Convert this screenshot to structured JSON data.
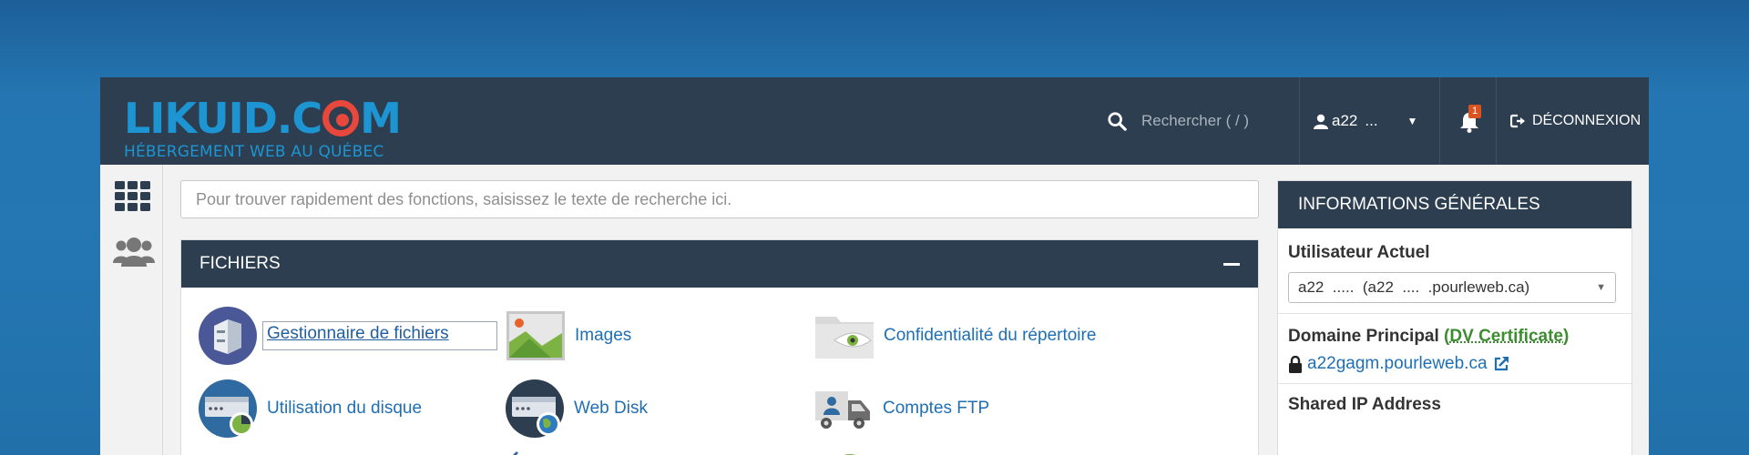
{
  "brand": {
    "logo_pre": "LIKUID.C",
    "logo_post": "M",
    "tagline": "HÉBERGEMENT WEB AU QUÉBEC"
  },
  "topbar": {
    "search_placeholder": "Rechercher ( / )",
    "username": "a22",
    "username_mask": "...",
    "notification_count": "1",
    "logout_label": "DÉCONNEXION"
  },
  "main": {
    "function_search_placeholder": "Pour trouver rapidement des fonctions, saisissez le texte de recherche ici.",
    "files_panel": {
      "title": "FICHIERS",
      "items": [
        {
          "label": "Gestionnaire de fichiers",
          "icon": "file-manager-icon"
        },
        {
          "label": "Images",
          "icon": "images-icon"
        },
        {
          "label": "Confidentialité du répertoire",
          "icon": "directory-privacy-icon"
        },
        {
          "label": "Utilisation du disque",
          "icon": "disk-usage-icon"
        },
        {
          "label": "Web Disk",
          "icon": "web-disk-icon"
        },
        {
          "label": "Comptes FTP",
          "icon": "ftp-accounts-icon"
        }
      ]
    }
  },
  "general_info": {
    "title": "INFORMATIONS GÉNÉRALES",
    "current_user_label": "Utilisateur Actuel",
    "current_user_value": "a22  .....  (a22  ....  .pourleweb.ca)",
    "primary_domain_label": "Domaine Principal",
    "cert_open": " (",
    "cert_label": "DV Certificate",
    "cert_close": ")",
    "primary_domain_value": "a22gagm.pourleweb.ca",
    "shared_ip_label": "Shared IP Address"
  },
  "colors": {
    "header_bg": "#2d3e50",
    "brand_blue": "#1d95d3",
    "brand_red": "#e8473c",
    "link": "#1f6fb5",
    "cert_green": "#3c8d2f",
    "badge": "#d9541e"
  }
}
